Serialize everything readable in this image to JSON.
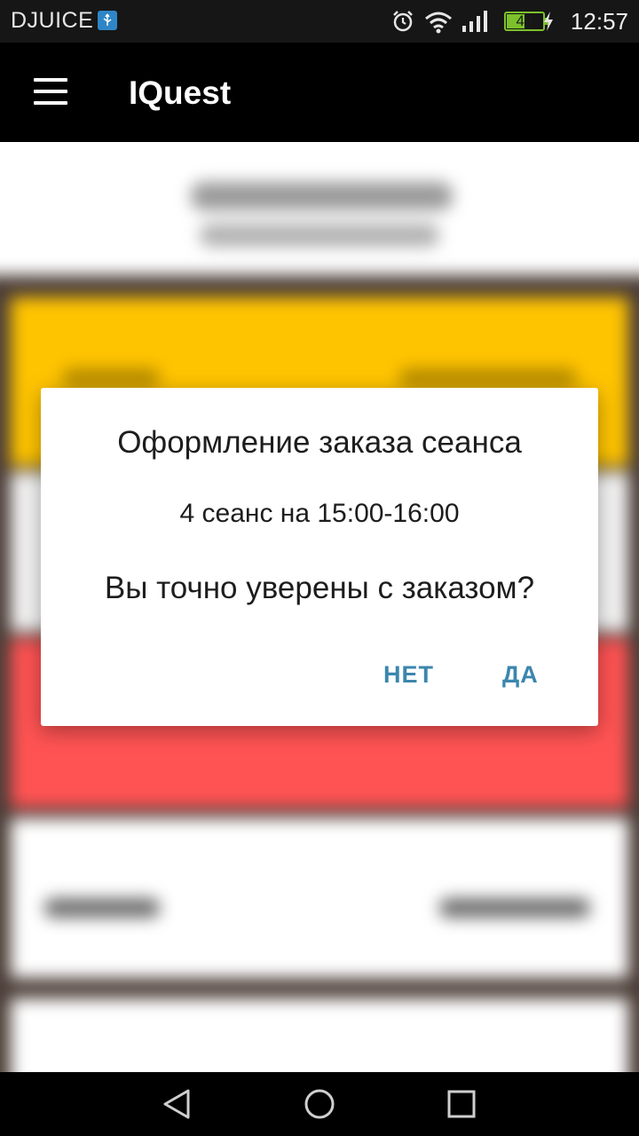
{
  "status_bar": {
    "carrier": "DJUICE",
    "battery": "49",
    "time": "12:57",
    "icons": [
      "usb-icon",
      "alarm-icon",
      "wifi-icon",
      "signal-icon",
      "battery-icon",
      "charging-icon"
    ]
  },
  "app_bar": {
    "title": "IQuest",
    "menu_icon": "hamburger-menu-icon"
  },
  "background_colors": {
    "yellow": "#ffc400",
    "red": "#ff5353",
    "dark": "#4b3d37"
  },
  "dialog": {
    "title": "Оформление заказа сеанса",
    "session": "4 сеанс на 15:00-16:00",
    "question": "Вы точно уверены с заказом?",
    "no_label": "НЕТ",
    "yes_label": "ДА",
    "button_color": "#3b86ad"
  },
  "nav_bar": {
    "icons": [
      "back-icon",
      "home-icon",
      "recents-icon"
    ]
  }
}
